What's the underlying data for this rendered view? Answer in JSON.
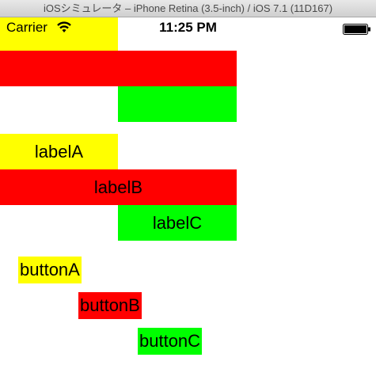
{
  "window": {
    "title": "iOSシミュレータ – iPhone Retina (3.5-inch) / iOS 7.1 (11D167)"
  },
  "status_bar": {
    "carrier": "Carrier",
    "time": "11:25 PM",
    "icons": [
      "wifi-icon",
      "battery-icon"
    ]
  },
  "labels": [
    "labelA",
    "labelB",
    "labelC"
  ],
  "buttons": [
    "buttonA",
    "buttonB",
    "buttonC"
  ],
  "colors": {
    "yellow": "#ffff00",
    "red": "#ff0000",
    "green": "#00ff00"
  }
}
